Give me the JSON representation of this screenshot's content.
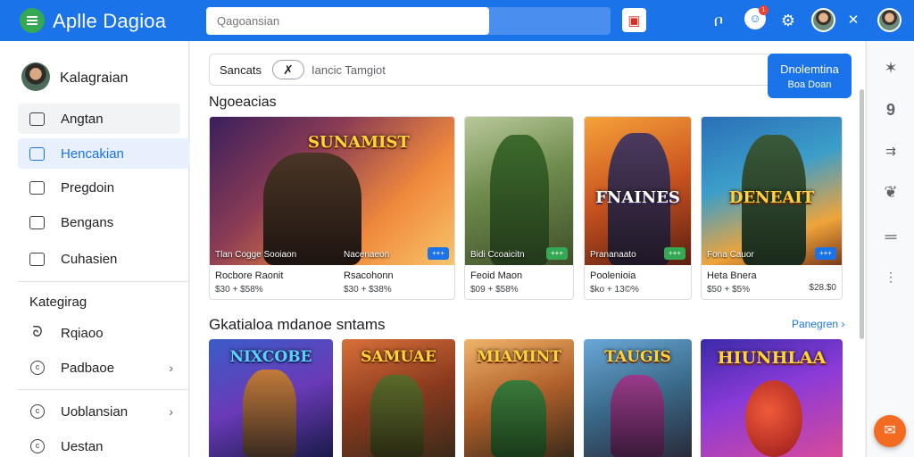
{
  "app": {
    "title": "Aplle Dagioa"
  },
  "search": {
    "placeholder": "Qagoansian"
  },
  "header": {
    "notification_count": "1"
  },
  "sidebar": {
    "user_name": "Kalagraian",
    "items": [
      {
        "label": "Angtan",
        "icon": "library-icon"
      },
      {
        "label": "Hencakian",
        "icon": "inbox-icon"
      },
      {
        "label": "Pregdoin",
        "icon": "page-icon"
      },
      {
        "label": "Bengans",
        "icon": "puzzle-icon"
      },
      {
        "label": "Cuhasien",
        "icon": "bag-icon"
      }
    ],
    "category_title": "Kategirag",
    "categories": [
      {
        "label": "Rqiaoo",
        "icon": "swirl-icon"
      },
      {
        "label": "Padbaoe",
        "icon": "circle-icon"
      },
      {
        "label": "Uoblansian",
        "icon": "circle-icon"
      },
      {
        "label": "Uestan",
        "icon": "circle-icon"
      }
    ]
  },
  "filter": {
    "label": "Sancats",
    "chip": "✗",
    "input_text": "Iancic Tamgiot",
    "download_button": {
      "line1": "Dnolemtina",
      "line2": "Boa Doan"
    }
  },
  "sections": {
    "featured_title": "Ngoeacias",
    "recent_title": "Gkatialoa mdanoe sntams",
    "see_more": "Panegren ›"
  },
  "featured": [
    {
      "art_title": "SUNAMIST",
      "caption_left": "Tlan Cogge Sooiaon",
      "caption_right": "Nacenaeon",
      "badge": "+++",
      "badge_color": "#1a73e8",
      "name_left": "Rocbore Raonit",
      "meta_left": "$30 + $58%",
      "name_right": "Rsacohonn",
      "meta_right": "$30 + $38%"
    },
    {
      "art_title": "",
      "caption_left": "Bidi Ccoaicitn",
      "badge": "+++",
      "badge_color": "#34a853",
      "name_left": "Feoid Maon",
      "meta_left": "$09 + $58%"
    },
    {
      "art_title": "FNAINES",
      "caption_left": "Prananaato",
      "badge": "+++",
      "badge_color": "#34a853",
      "name_left": "Poolenioia",
      "meta_left": "$ko + 13©%"
    },
    {
      "art_title": "DENEAIT",
      "caption_left": "Fona Cauor",
      "badge": "+++",
      "badge_color": "#1a73e8",
      "name_left": "Heta Bnera",
      "meta_left": "$50 + $5%",
      "share": "$28.$0"
    }
  ],
  "recent": [
    {
      "art_title": "NIXCOBE"
    },
    {
      "art_title": "SAMUAE"
    },
    {
      "art_title": "MIAMINT"
    },
    {
      "art_title": "TAUGIS"
    },
    {
      "art_title": "HIUNHLAA"
    }
  ],
  "rail": {
    "icons": [
      "star-icon",
      "help-icon",
      "code-icon",
      "leaf-icon",
      "menu-lines-icon",
      "more-icon"
    ]
  }
}
